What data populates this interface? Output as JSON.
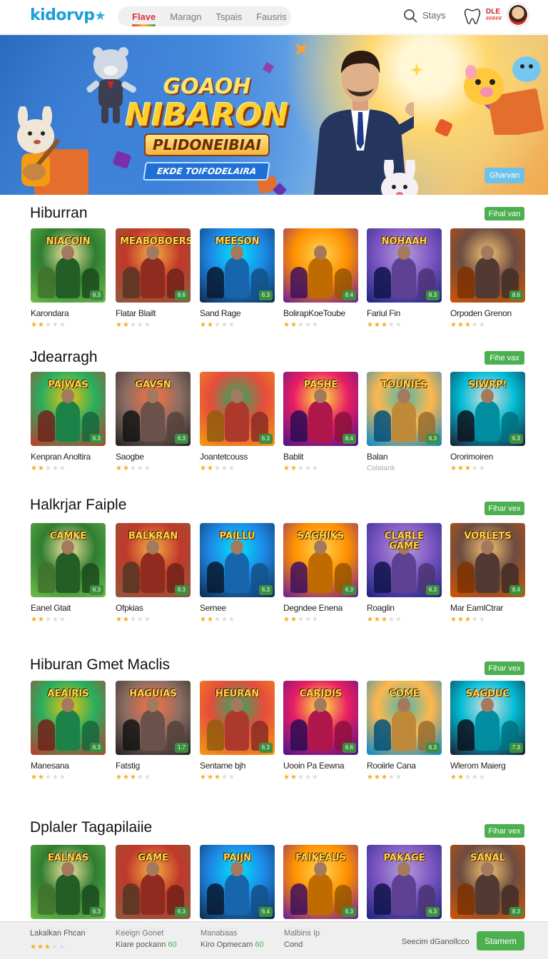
{
  "header": {
    "logo": "kidorvp",
    "logo_star": "★",
    "tabs": [
      "Flave",
      "Maragn",
      "Tspais",
      "Fausris"
    ],
    "search_label": "Stays",
    "badge_top": "DLE",
    "badge_bottom": "₽₽₽₽₽"
  },
  "banner": {
    "line1": "GOAOH",
    "line2": "NIBARON",
    "line3": "PLIDONEIBIAI",
    "line4": "EKDE TOIFODELAIRA",
    "cta": "Gharvan"
  },
  "sections": [
    {
      "title": "Hiburran",
      "see_all": "Fihal van",
      "cards": [
        {
          "name": "Karondara",
          "stars": 2,
          "chip": "6.3",
          "art": "NIACOIN"
        },
        {
          "name": "Flatar Blailt",
          "stars": 2,
          "chip": "8.6",
          "art": "MEABOBOERS"
        },
        {
          "name": "Sand Rage",
          "stars": 2,
          "chip": "6.3",
          "art": "MEESON"
        },
        {
          "name": "BolirapKoeToube",
          "stars": 2,
          "chip": "8.4",
          "art": ""
        },
        {
          "name": "Fariul Fin",
          "stars": 3,
          "chip": "8.3",
          "art": "NOHAAH"
        },
        {
          "name": "Orpoden Grenon",
          "stars": 3,
          "chip": "8.6",
          "art": ""
        }
      ]
    },
    {
      "title": "Jdearragh",
      "see_all": "Fihe vax",
      "cards": [
        {
          "name": "Kenpran Anoltira",
          "stars": 2,
          "chip": "6.3",
          "art": "PAJWAS"
        },
        {
          "name": "Saogbe",
          "stars": 2,
          "chip": "6.3",
          "art": "GAVSN"
        },
        {
          "name": "Joantetcouss",
          "stars": 2,
          "chip": "6.3",
          "art": ""
        },
        {
          "name": "Bablit",
          "stars": 2,
          "chip": "8.4",
          "art": "PASHE"
        },
        {
          "name": "Balan",
          "stars": 0,
          "chip": "6.3",
          "art": "TOUNIES",
          "sub": "Colatank"
        },
        {
          "name": "Ororimoiren",
          "stars": 3,
          "chip": "6.3",
          "art": "SIWRP!"
        }
      ]
    },
    {
      "title": "Halkrjar Faiple",
      "see_all": "Fihar vex",
      "cards": [
        {
          "name": "Eanel Gtait",
          "stars": 2,
          "chip": "6.3",
          "art": "CAMKE"
        },
        {
          "name": "Ofpkias",
          "stars": 2,
          "chip": "8.3",
          "art": "BALKRAN"
        },
        {
          "name": "Sernee",
          "stars": 2,
          "chip": "6.3",
          "art": "PAILLU"
        },
        {
          "name": "Degndee Enena",
          "stars": 2,
          "chip": "6.3",
          "art": "SAGHIKS"
        },
        {
          "name": "Roaglin",
          "stars": 3,
          "chip": "6.3",
          "art": "CLARLE GAME"
        },
        {
          "name": "Mar EamlCtrar",
          "stars": 3,
          "chip": "8.4",
          "art": "VORLETS"
        }
      ]
    },
    {
      "title": "Hiburan Gmet Maclis",
      "see_all": "Fihar vex",
      "cards": [
        {
          "name": "Manesana",
          "stars": 2,
          "chip": "6.3",
          "art": "AEAIRIS"
        },
        {
          "name": "Fatstig",
          "stars": 3,
          "chip": "1.7",
          "art": "HAGUIAS"
        },
        {
          "name": "Sentame bjh",
          "stars": 3,
          "chip": "6.3",
          "art": "HEURAN"
        },
        {
          "name": "Uooin Pa Eewna",
          "stars": 2,
          "chip": "6.6",
          "art": "CARIDIS"
        },
        {
          "name": "Rooiirle Cana",
          "stars": 3,
          "chip": "6.3",
          "art": "COME"
        },
        {
          "name": "Wlerom Maierg",
          "stars": 2,
          "chip": "7.3",
          "art": "SAGDUC"
        }
      ]
    },
    {
      "title": "Dplaler Tagapilaiie",
      "see_all": "Fihar vex",
      "cards": [
        {
          "name": "Lakalkan Fhcan",
          "stars": 3,
          "chip": "6.3",
          "art": "EALNAS"
        },
        {
          "name": "Keeign Gonet",
          "stars": 0,
          "chip": "6.3",
          "art": "GAME"
        },
        {
          "name": "Manabaas",
          "stars": 0,
          "chip": "6.4",
          "art": "PAIJN"
        },
        {
          "name": "Malbins Ip",
          "stars": 0,
          "chip": "6.3",
          "art": "FAIKEAUS"
        },
        {
          "name": "",
          "stars": 0,
          "chip": "6.3",
          "art": "PAKAGE"
        },
        {
          "name": "",
          "stars": 0,
          "chip": "8.3",
          "art": "SANAL"
        }
      ]
    }
  ],
  "bottom": {
    "col1_line1": "Lakalkan Fhcan",
    "col2_line1": "Keeign Gonet",
    "col2_line2": "Kiare pockann",
    "col2_green": "60",
    "col3_line1": "Manabaas",
    "col3_line2": "Kiro Opmecam",
    "col3_green": "60",
    "col4_line1": "Malbins Ip",
    "col4_line2": "Cond",
    "search": "Seecim dGanollcco",
    "button": "Stamem"
  },
  "colors": {
    "brand": "#1a9fd6",
    "green": "#4caf50",
    "star": "#f2b01e",
    "active_tab": "#d9353a"
  },
  "icons": [
    "search-icon",
    "tooth-icon",
    "star-icon"
  ]
}
